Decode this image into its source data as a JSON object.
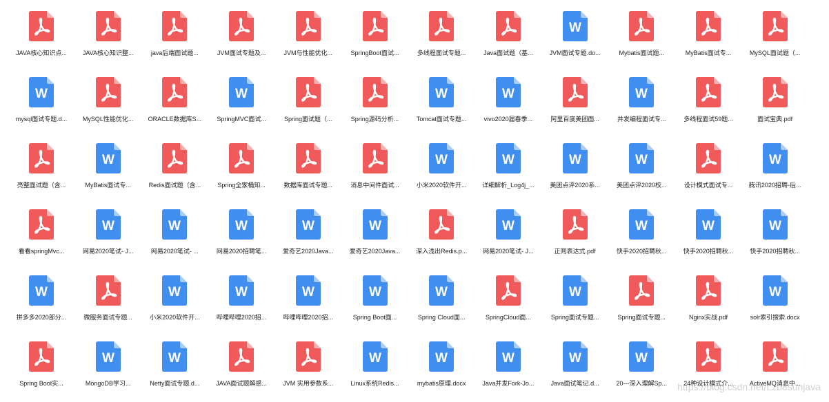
{
  "colors": {
    "pdf": "#f05a5a",
    "pdf_fold": "#f9b0b0",
    "word": "#3f8ef0",
    "word_fold": "#a9cdfa"
  },
  "files": [
    {
      "name": "JAVA核心知识点...",
      "type": "pdf"
    },
    {
      "name": "JAVA核心知识整...",
      "type": "pdf"
    },
    {
      "name": "java后端面试题...",
      "type": "pdf"
    },
    {
      "name": "JVM面试专题及...",
      "type": "pdf"
    },
    {
      "name": "JVM与性能优化...",
      "type": "pdf"
    },
    {
      "name": "SpringBoot面试...",
      "type": "pdf"
    },
    {
      "name": "多线程面试专题...",
      "type": "pdf"
    },
    {
      "name": "Java面试题（基...",
      "type": "pdf"
    },
    {
      "name": "JVM面试专题.do...",
      "type": "word"
    },
    {
      "name": "Mybatis面试题...",
      "type": "pdf"
    },
    {
      "name": "MyBatis面试专...",
      "type": "pdf"
    },
    {
      "name": "MySQL面试题（...",
      "type": "pdf"
    },
    {
      "name": "mysql面试专题.d...",
      "type": "word"
    },
    {
      "name": "MySQL性能优化...",
      "type": "pdf"
    },
    {
      "name": "ORACLE数据库S...",
      "type": "pdf"
    },
    {
      "name": "SpringMVC面试...",
      "type": "word"
    },
    {
      "name": "Spring面试题（...",
      "type": "pdf"
    },
    {
      "name": "Spring源码分析...",
      "type": "pdf"
    },
    {
      "name": "Tomcat面试专题...",
      "type": "word"
    },
    {
      "name": "vivo2020届春季...",
      "type": "word"
    },
    {
      "name": "阿里百度美团面...",
      "type": "pdf"
    },
    {
      "name": "并发编程面试专...",
      "type": "word"
    },
    {
      "name": "多线程面试59题...",
      "type": "pdf"
    },
    {
      "name": "面试宝典.pdf",
      "type": "pdf"
    },
    {
      "name": "亮整面试题（含...",
      "type": "pdf"
    },
    {
      "name": "MyBatis面试专...",
      "type": "word"
    },
    {
      "name": "Redis面试题（含...",
      "type": "pdf"
    },
    {
      "name": "Spring全家桶知...",
      "type": "pdf"
    },
    {
      "name": "数据库面试专题...",
      "type": "pdf"
    },
    {
      "name": "消息中间件面试...",
      "type": "pdf"
    },
    {
      "name": "小米2020软件开...",
      "type": "word"
    },
    {
      "name": "详细解析_Log4j_...",
      "type": "word"
    },
    {
      "name": "美团点评2020系...",
      "type": "word"
    },
    {
      "name": "美团点评2020校...",
      "type": "word"
    },
    {
      "name": "设计模式面试专...",
      "type": "pdf"
    },
    {
      "name": "腾讯2020招聘-后...",
      "type": "word"
    },
    {
      "name": "看看springMvc...",
      "type": "pdf"
    },
    {
      "name": "网易2020笔试- J...",
      "type": "word"
    },
    {
      "name": "网易2020笔试- ...",
      "type": "word"
    },
    {
      "name": "网易2020招聘笔...",
      "type": "word"
    },
    {
      "name": "爱奇艺2020Java...",
      "type": "word"
    },
    {
      "name": "爱奇艺2020Java...",
      "type": "word"
    },
    {
      "name": "深入浅出Redis.p...",
      "type": "pdf"
    },
    {
      "name": "网易2020笔试- J...",
      "type": "word"
    },
    {
      "name": "正则表达式.pdf",
      "type": "pdf"
    },
    {
      "name": "快手2020招聘秋...",
      "type": "word"
    },
    {
      "name": "快手2020招聘秋...",
      "type": "word"
    },
    {
      "name": "快手2020招聘秋...",
      "type": "word"
    },
    {
      "name": "拼多多2020部分...",
      "type": "word"
    },
    {
      "name": "微服务面试专题...",
      "type": "pdf"
    },
    {
      "name": "小米2020软件开...",
      "type": "word"
    },
    {
      "name": "哔哩哔哩2020招...",
      "type": "word"
    },
    {
      "name": "哔哩哔哩2020招...",
      "type": "word"
    },
    {
      "name": "Spring Boot面...",
      "type": "word"
    },
    {
      "name": "Spring Cloud面...",
      "type": "word"
    },
    {
      "name": "SpringCloud面...",
      "type": "pdf"
    },
    {
      "name": "Spring面试专题...",
      "type": "word"
    },
    {
      "name": "Spring面试专题...",
      "type": "pdf"
    },
    {
      "name": "Nginx实战.pdf",
      "type": "pdf"
    },
    {
      "name": "solr索引搜索.docx",
      "type": "word"
    },
    {
      "name": "Spring Boot实...",
      "type": "pdf"
    },
    {
      "name": "MongoDB学习...",
      "type": "word"
    },
    {
      "name": "Netty面试专题.d...",
      "type": "word"
    },
    {
      "name": "JAVA面试题解惑...",
      "type": "pdf"
    },
    {
      "name": "JVM 实用参数系...",
      "type": "pdf"
    },
    {
      "name": "Linux系统Redis...",
      "type": "word"
    },
    {
      "name": "mybatis原理.docx",
      "type": "word"
    },
    {
      "name": "Java并发Fork-Jo...",
      "type": "word"
    },
    {
      "name": "Java面试笔记.d...",
      "type": "word"
    },
    {
      "name": "20---深入理解Sp...",
      "type": "word"
    },
    {
      "name": "24种设计模式介...",
      "type": "pdf"
    },
    {
      "name": "ActiveMQ消息中...",
      "type": "pdf"
    }
  ],
  "watermark": "https://blog.csdn.net/Lzb8sunjava"
}
